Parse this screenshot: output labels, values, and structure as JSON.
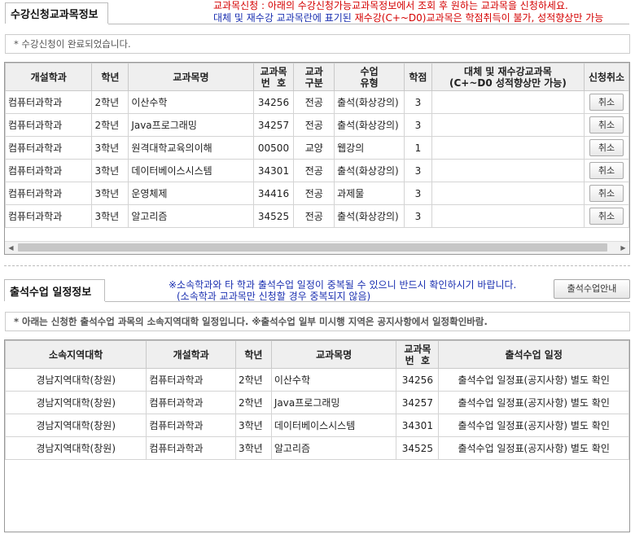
{
  "section1": {
    "title": "수강신청교과목정보",
    "notice_line1_red1": "교과목신청 : ",
    "notice_line1_red2": "아래의 수강신청가능교과목정보에서 조회 후 원하는 교과목을 신청하세요.",
    "notice_line2_blue": "대체 및 재수강 교과목란에 표기된 ",
    "notice_line2_red": "재수강(C+~D0)교과목은 학점취득이 불가, 성적향상만 가능",
    "info": "* 수강신청이 완료되었습니다.",
    "columns": [
      {
        "line1": "개설학과",
        "line2": ""
      },
      {
        "line1": "학년",
        "line2": ""
      },
      {
        "line1": "교과목명",
        "line2": ""
      },
      {
        "line1": "교과목",
        "line2": "번  호"
      },
      {
        "line1": "교과",
        "line2": "구분"
      },
      {
        "line1": "수업",
        "line2": "유형"
      },
      {
        "line1": "학점",
        "line2": ""
      },
      {
        "line1": "대체 및 재수강교과목",
        "line2": "(C+~D0 성적향상만 가능)"
      },
      {
        "line1": "신청취소",
        "line2": ""
      }
    ],
    "cancel_label": "취소",
    "rows": [
      {
        "dept": "컴퓨터과학과",
        "year": "2학년",
        "course": "이산수학",
        "code": "34256",
        "type": "전공",
        "mode": "출석(화상강의)",
        "credit": "3",
        "replace": ""
      },
      {
        "dept": "컴퓨터과학과",
        "year": "2학년",
        "course": "Java프로그래밍",
        "code": "34257",
        "type": "전공",
        "mode": "출석(화상강의)",
        "credit": "3",
        "replace": ""
      },
      {
        "dept": "컴퓨터과학과",
        "year": "3학년",
        "course": "원격대학교육의이해",
        "code": "00500",
        "type": "교양",
        "mode": "웹강의",
        "credit": "1",
        "replace": ""
      },
      {
        "dept": "컴퓨터과학과",
        "year": "3학년",
        "course": "데이터베이스시스템",
        "code": "34301",
        "type": "전공",
        "mode": "출석(화상강의)",
        "credit": "3",
        "replace": ""
      },
      {
        "dept": "컴퓨터과학과",
        "year": "3학년",
        "course": "운영체제",
        "code": "34416",
        "type": "전공",
        "mode": "과제물",
        "credit": "3",
        "replace": ""
      },
      {
        "dept": "컴퓨터과학과",
        "year": "3학년",
        "course": "알고리즘",
        "code": "34525",
        "type": "전공",
        "mode": "출석(화상강의)",
        "credit": "3",
        "replace": ""
      }
    ]
  },
  "section2": {
    "title": "출석수업 일정정보",
    "notice_line1": "※소속학과와 타 학과 출석수업 일정이 중복될 수 있으니 반드시 확인하시기 바랍니다.",
    "notice_line2": "(소속학과 교과목만 신청할 경우 중복되지 않음)",
    "guide_button": "출석수업안내",
    "info": "* 아래는 신청한 출석수업 과목의 소속지역대학 일정입니다. ※출석수업 일부 미시행 지역은 공지사항에서 일정확인바람.",
    "columns": [
      {
        "line1": "소속지역대학",
        "line2": ""
      },
      {
        "line1": "개설학과",
        "line2": ""
      },
      {
        "line1": "학년",
        "line2": ""
      },
      {
        "line1": "교과목명",
        "line2": ""
      },
      {
        "line1": "교과목",
        "line2": "번  호"
      },
      {
        "line1": "출석수업 일정",
        "line2": ""
      }
    ],
    "rows": [
      {
        "region": "경남지역대학(창원)",
        "dept": "컴퓨터과학과",
        "year": "2학년",
        "course": "이산수학",
        "code": "34256",
        "schedule": "출석수업 일정표(공지사항) 별도 확인"
      },
      {
        "region": "경남지역대학(창원)",
        "dept": "컴퓨터과학과",
        "year": "2학년",
        "course": "Java프로그래밍",
        "code": "34257",
        "schedule": "출석수업 일정표(공지사항) 별도 확인"
      },
      {
        "region": "경남지역대학(창원)",
        "dept": "컴퓨터과학과",
        "year": "3학년",
        "course": "데이터베이스시스템",
        "code": "34301",
        "schedule": "출석수업 일정표(공지사항) 별도 확인"
      },
      {
        "region": "경남지역대학(창원)",
        "dept": "컴퓨터과학과",
        "year": "3학년",
        "course": "알고리즘",
        "code": "34525",
        "schedule": "출석수업 일정표(공지사항) 별도 확인"
      }
    ]
  },
  "icons": {
    "scroll_left": "scroll-left-arrow",
    "scroll_right": "scroll-right-arrow"
  }
}
